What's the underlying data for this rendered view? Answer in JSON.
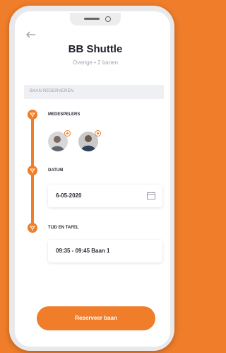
{
  "header": {
    "title": "BB Shuttle",
    "subtitle": "Overige • 2 banen"
  },
  "section": {
    "title": "BAAN RESERVEREN"
  },
  "steps": {
    "players_label": "MEDESPELERS",
    "date_label": "DATUM",
    "date_value": "6-05-2020",
    "time_label": "TIJD EN TAFEL",
    "time_value": "09:35 - 09:45 Baan 1"
  },
  "cta": {
    "label": "Reserveer baan"
  },
  "colors": {
    "accent": "#ef7d2a",
    "section_bg": "#eef0f3",
    "title": "#1f1f2b"
  },
  "icons": [
    "back-arrow-icon",
    "shuttlecock-icon",
    "calendar-icon"
  ]
}
